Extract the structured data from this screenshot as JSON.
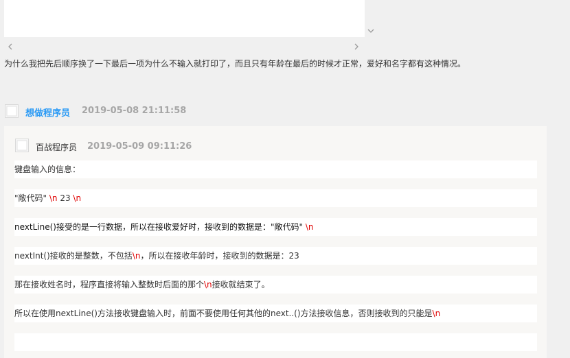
{
  "question_text": "为什么我把先后顺序换了一下最后一项为什么不输入就打印了，而且只有年龄在最后的时候才正常，爱好和名字都有这种情况。",
  "comment": {
    "username": "想做程序员",
    "timestamp": "2019-05-08 21:11:58"
  },
  "reply": {
    "username": "百战程序员",
    "timestamp": "2019-05-09 09:11:26",
    "paragraphs": {
      "p1": "键盘输入的信息：",
      "p2_a": "\"敞代码\" ",
      "p2_b": "\\n",
      "p2_c": " 23 ",
      "p2_d": "\\n",
      "p3_a": "nextLine()接受的是一行数据，所以在接收爱好时，接收到的数据是：\"敞代码\" ",
      "p3_b": "\\n",
      "p4_a": "nextInt()接收的是整数，不包括",
      "p4_b": "\\n",
      "p4_c": "，所以在接收年龄时，接收到的数据是：23",
      "p5_a": "那在接收姓名时，程序直接将输入整数时后面的那个",
      "p5_b": "\\n",
      "p5_c": "接收就结束了。",
      "p6_a": "所以在使用nextLine()方法接收键盘输入时，前面不要使用任何其他的next..()方法接收信息，否则接收到的只能是",
      "p6_b": "\\n"
    }
  },
  "colors": {
    "username_link": "#2a9af5",
    "timestamp": "#a6a6a6",
    "newline_highlight": "#e00000",
    "reply_panel_bg": "#f8f7f5",
    "page_bg": "#f0f0f0"
  },
  "icons": {
    "vertical_scroll": "chevron-down-icon",
    "horizontal_scroll_left": "chevron-left-icon",
    "horizontal_scroll_right": "chevron-right-icon",
    "avatar": "avatar-placeholder-icon"
  }
}
